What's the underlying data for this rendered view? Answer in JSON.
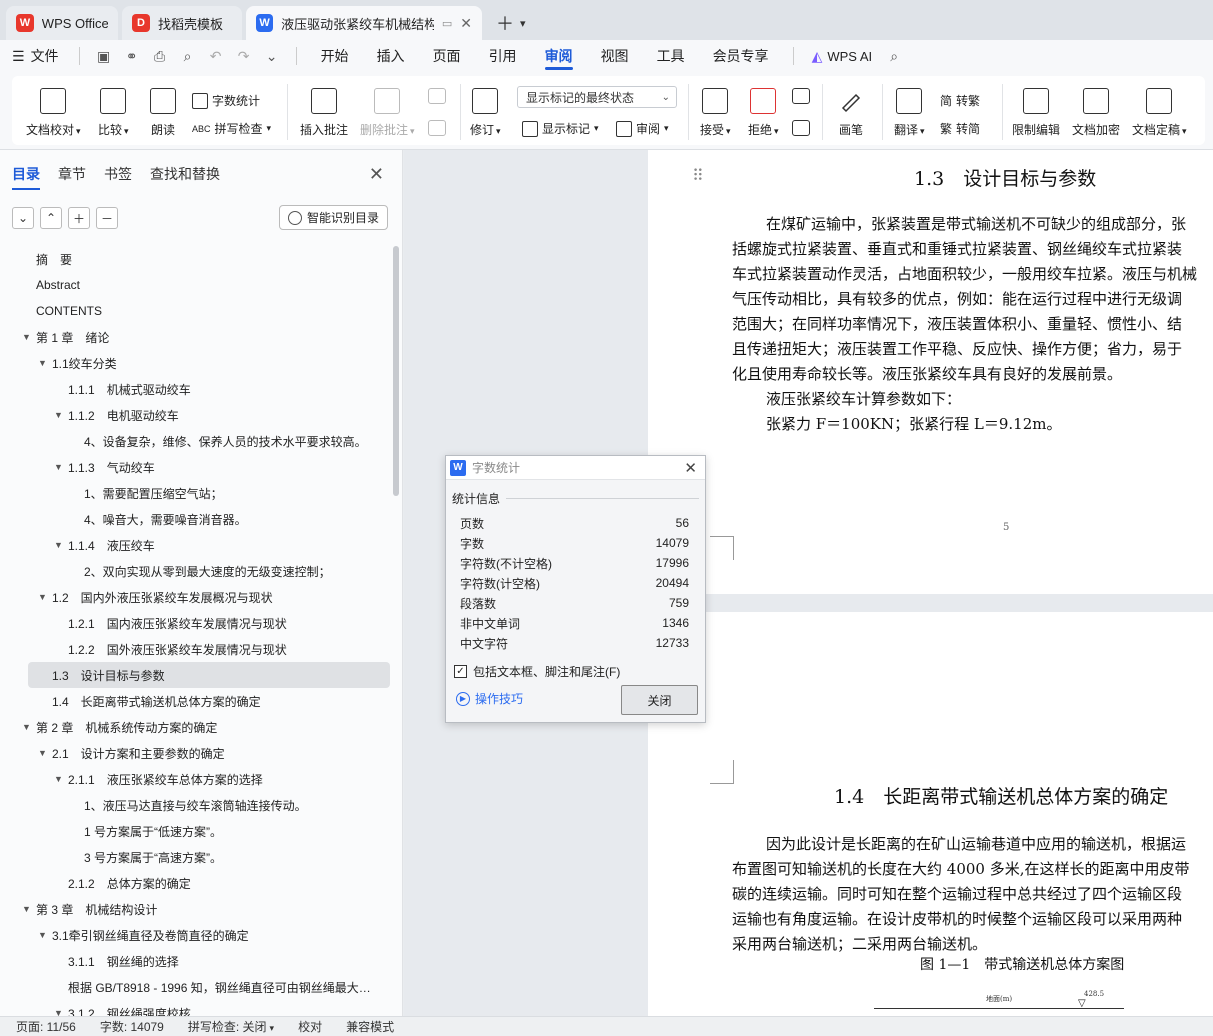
{
  "tabs": [
    {
      "label": "WPS Office",
      "logo": "W",
      "logo_color": "#e8372c"
    },
    {
      "label": "找稻壳模板",
      "logo": "D",
      "logo_color": "#e8372c"
    },
    {
      "label": "液压驱动张紧绞车机械结构设计",
      "logo": "W",
      "logo_color": "#2c6cf0"
    }
  ],
  "menu": {
    "file_label": "文件",
    "items": [
      "开始",
      "插入",
      "页面",
      "引用",
      "审阅",
      "视图",
      "工具",
      "会员专享"
    ],
    "active_item": "审阅",
    "wps_ai": "WPS AI"
  },
  "ribbon": {
    "doc_proof": "文档校对",
    "compare": "比较",
    "read_aloud": "朗读",
    "word_count": "字数统计",
    "spell_check": "拼写检查",
    "insert_comment": "插入批注",
    "delete_comment": "删除批注",
    "track_changes": "修订",
    "markup_dropdown": "显示标记的最终状态",
    "show_markup": "显示标记",
    "review": "审阅",
    "accept": "接受",
    "reject": "拒绝",
    "pen": "画笔",
    "translate": "翻译",
    "to_traditional": "转繁",
    "to_simplified": "转简",
    "restrict_edit": "限制编辑",
    "doc_encrypt": "文档加密",
    "doc_finalize": "文档定稿"
  },
  "nav": {
    "tabs": [
      "目录",
      "章节",
      "书签",
      "查找和替换"
    ],
    "smart_toc_label": "智能识别目录",
    "toc": [
      {
        "text": "摘　要",
        "level": 0,
        "arrow": false
      },
      {
        "text": "Abstract",
        "level": 0,
        "arrow": false
      },
      {
        "text": "CONTENTS",
        "level": 0,
        "arrow": false
      },
      {
        "text": "第 1 章　绪论",
        "level": 0,
        "arrow": true
      },
      {
        "text": "1.1绞车分类",
        "level": 1,
        "arrow": true
      },
      {
        "text": "1.1.1　机械式驱动绞车",
        "level": 2,
        "arrow": false
      },
      {
        "text": "1.1.2　电机驱动绞车",
        "level": 2,
        "arrow": true
      },
      {
        "text": "4、设备复杂，维修、保养人员的技术水平要求较高。",
        "level": 3,
        "arrow": false
      },
      {
        "text": "1.1.3　气动绞车",
        "level": 2,
        "arrow": true
      },
      {
        "text": "1、需要配置压缩空气站；",
        "level": 3,
        "arrow": false
      },
      {
        "text": "4、噪音大，需要噪音消音器。",
        "level": 3,
        "arrow": false
      },
      {
        "text": "1.1.4　液压绞车",
        "level": 2,
        "arrow": true
      },
      {
        "text": "2、双向实现从零到最大速度的无级变速控制；",
        "level": 3,
        "arrow": false
      },
      {
        "text": "1.2　国内外液压张紧绞车发展概况与现状",
        "level": 1,
        "arrow": true
      },
      {
        "text": "1.2.1　国内液压张紧绞车发展情况与现状",
        "level": 2,
        "arrow": false
      },
      {
        "text": "1.2.2　国外液压张紧绞车发展情况与现状",
        "level": 2,
        "arrow": false
      },
      {
        "text": "1.3　设计目标与参数",
        "level": 1,
        "arrow": false,
        "selected": true
      },
      {
        "text": "1.4　长距离带式输送机总体方案的确定",
        "level": 1,
        "arrow": false
      },
      {
        "text": "第 2 章　机械系统传动方案的确定",
        "level": 0,
        "arrow": true
      },
      {
        "text": "2.1　设计方案和主要参数的确定",
        "level": 1,
        "arrow": true
      },
      {
        "text": "2.1.1　液压张紧绞车总体方案的选择",
        "level": 2,
        "arrow": true
      },
      {
        "text": "1、液压马达直接与绞车滚筒轴连接传动。",
        "level": 3,
        "arrow": false
      },
      {
        "text": "1 号方案属于“低速方案”。",
        "level": 3,
        "arrow": false
      },
      {
        "text": "3 号方案属于“高速方案”。",
        "level": 3,
        "arrow": false
      },
      {
        "text": "2.1.2　总体方案的确定",
        "level": 2,
        "arrow": false
      },
      {
        "text": "第 3 章　机械结构设计",
        "level": 0,
        "arrow": true
      },
      {
        "text": "3.1牵引钢丝绳直径及卷筒直径的确定",
        "level": 1,
        "arrow": true
      },
      {
        "text": "3.1.1　钢丝绳的选择",
        "level": 2,
        "arrow": false
      },
      {
        "text": "根据 GB/T8918 - 1996 知，钢丝绳直径可由钢丝绳最大…",
        "level": 2,
        "arrow": false
      },
      {
        "text": "3.1.2　钢丝绳强度校核",
        "level": 2,
        "arrow": true
      }
    ]
  },
  "doc": {
    "page1": {
      "heading": "1.3　设计目标与参数",
      "lines": [
        "在煤矿运输中，张紧装置是带式输送机不可缺少的组成部分，张",
        "括螺旋式拉紧装置、垂直式和重锤式拉紧装置、钢丝绳绞车式拉紧装",
        "车式拉紧装置动作灵活，占地面积较少，一般用绞车拉紧。液压与机械",
        "气压传动相比，具有较多的优点，例如：能在运行过程中进行无级调",
        "范围大；在同样功率情况下，液压装置体积小、重量轻、惯性小、结",
        "且传递扭矩大；液压装置工作平稳、反应快、操作方便；省力，易于",
        "化且使用寿命较长等。液压张紧绞车具有良好的发展前景。",
        "液压张紧绞车计算参数如下：",
        "张紧力 F＝100KN；张紧行程 L＝9.12m。"
      ],
      "page_number": "5"
    },
    "page2": {
      "heading": "1.4　长距离带式输送机总体方案的确定",
      "lines": [
        "因为此设计是长距离的在矿山运输巷道中应用的输送机，根据运",
        "布置图可知输送机的长度在大约 4000 多米,在这样长的距离中用皮带",
        "碳的连续运输。同时可知在整个运输过程中总共经过了四个运输区段",
        "运输也有角度运输。在设计皮带机的时候整个运输区段可以采用两种",
        "采用两台输送机；二采用两台输送机。"
      ],
      "figure_caption": "图 1—1　带式输送机总体方案图",
      "fig_label_a": "地面(m)",
      "fig_label_b": "428.5"
    }
  },
  "dialog": {
    "title": "字数统计",
    "section": "统计信息",
    "rows": [
      {
        "label": "页数",
        "value": "56"
      },
      {
        "label": "字数",
        "value": "14079"
      },
      {
        "label": "字符数(不计空格)",
        "value": "17996"
      },
      {
        "label": "字符数(计空格)",
        "value": "20494"
      },
      {
        "label": "段落数",
        "value": "759"
      },
      {
        "label": "非中文单词",
        "value": "1346"
      },
      {
        "label": "中文字符",
        "value": "12733"
      }
    ],
    "checkbox_label": "包括文本框、脚注和尾注(F)",
    "checkbox_checked": true,
    "tips_label": "操作技巧",
    "close_label": "关闭"
  },
  "status": {
    "page": "页面: 11/56",
    "words": "字数: 14079",
    "spell": "拼写检查: 关闭",
    "proof": "校对",
    "compat": "兼容模式"
  },
  "colors": {
    "accent": "#1e5bd8",
    "wps_red": "#e8372c",
    "wps_blue": "#2c6cf0"
  }
}
